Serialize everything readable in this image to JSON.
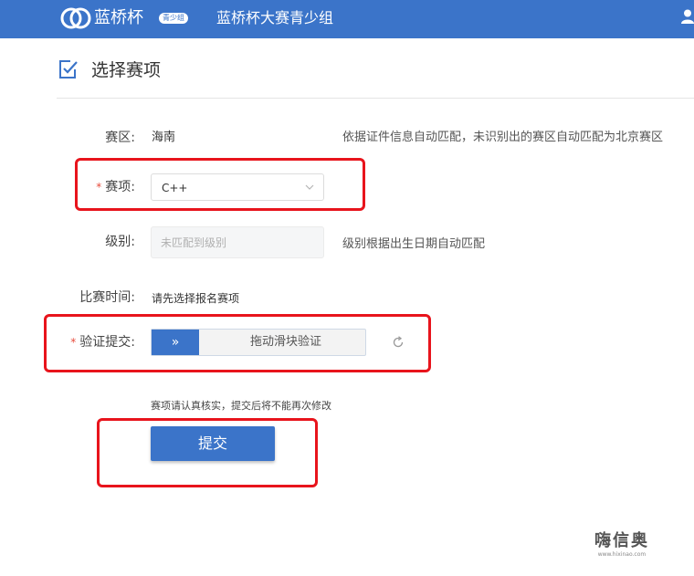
{
  "header": {
    "logo_text": "蓝桥杯",
    "badge": "青少组",
    "app_title": "蓝桥杯大赛青少组",
    "accent_color": "#3b74c9"
  },
  "section": {
    "icon": "checkbox-edit-icon",
    "title": "选择赛项"
  },
  "form": {
    "region": {
      "label": "赛区:",
      "value": "海南",
      "hint": "依据证件信息自动匹配，未识别出的赛区自动匹配为北京赛区"
    },
    "event": {
      "required_mark": "*",
      "label": "赛项:",
      "value": "C++"
    },
    "level": {
      "label": "级别:",
      "placeholder": "未匹配到级别",
      "hint": "级别根据出生日期自动匹配"
    },
    "time": {
      "label": "比赛时间:",
      "value": "请先选择报名赛项"
    },
    "verify": {
      "required_mark": "*",
      "label": "验证提交:",
      "handle_glyph": "»",
      "slider_text": "拖动滑块验证"
    },
    "notice": "赛项请认真核实，提交后将不能再次修改",
    "submit_label": "提交"
  },
  "watermark": {
    "main": "嗨信奥",
    "sub": "www.hixinao.com"
  },
  "annotation_color": "#e8141c"
}
